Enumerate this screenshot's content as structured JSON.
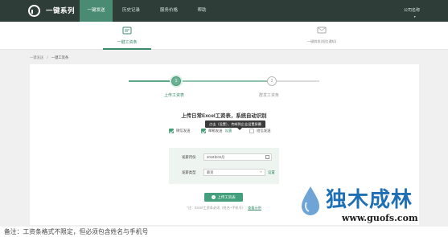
{
  "header": {
    "brand": "一键系列",
    "nav": [
      {
        "label": "一键发送",
        "active": true
      },
      {
        "label": "历史记录",
        "active": false
      },
      {
        "label": "服务价格",
        "active": false
      },
      {
        "label": "帮助",
        "active": false
      }
    ],
    "company": "公司名称",
    "company_caret": "▼"
  },
  "subtabs": [
    {
      "label": "一键工资条",
      "icon": "payslip-icon",
      "active": true
    },
    {
      "label": "一键群发(短信通知)",
      "icon": "sms-icon",
      "active": false
    }
  ],
  "breadcrumb": {
    "root": "一键发送",
    "sep": "/",
    "current": "一键工资条"
  },
  "steps": [
    {
      "number": "1",
      "label": "上传工资表",
      "active": true
    },
    {
      "number": "2",
      "label": "群发工资条",
      "active": false
    }
  ],
  "headline": "上传日常Excel工资表，系统自动识别",
  "channels": {
    "wechat": {
      "label": "微信发送",
      "checked": true
    },
    "email": {
      "label": "邮箱发送",
      "checked": true,
      "link": "设置"
    },
    "sms": {
      "label": "短信发送",
      "checked": false
    }
  },
  "tooltip": "点击（设置），传邮到企业设置屏幕",
  "form": {
    "month_label": "发薪月份",
    "month_value": "2018年02月",
    "type_label": "发薪类型",
    "type_value": "薪资",
    "type_link": "设置"
  },
  "upload_button": {
    "icon": "upload-icon",
    "label": "上传工资表"
  },
  "hint": {
    "text": "*注：Excel工资条必须（姓名+手机号）",
    "link": "查看示例"
  },
  "bottom_note": "备注：工资条格式不限定，但必须包含姓名与手机号",
  "watermark": {
    "title": "独木成林",
    "url": "www.guofs.com"
  },
  "colors": {
    "topbar": "#2e3d37",
    "accent": "#3b8a6a",
    "button": "#44a07c",
    "watermark": "#1f6fb4"
  }
}
